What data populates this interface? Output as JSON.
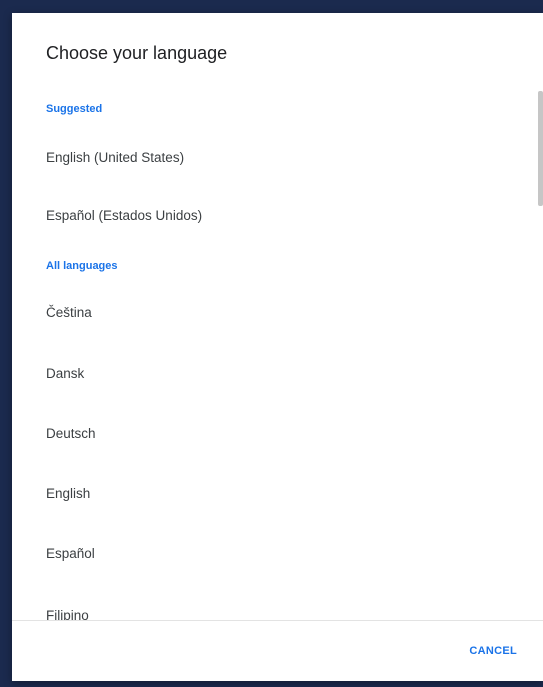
{
  "dialog": {
    "title": "Choose your language",
    "suggested_header": "Suggested",
    "suggested": [
      "English (United States)",
      "Español (Estados Unidos)"
    ],
    "all_header": "All languages",
    "all": [
      "Čeština",
      "Dansk",
      "Deutsch",
      "English",
      "Español",
      "Filipino"
    ],
    "cancel_label": "CANCEL"
  },
  "colors": {
    "accent": "#1a73e8",
    "backdrop": "#1b2a4e"
  }
}
